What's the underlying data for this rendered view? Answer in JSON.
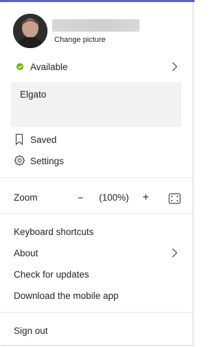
{
  "profile": {
    "change_picture_label": "Change picture"
  },
  "status": {
    "label": "Available",
    "color": "#6bb700",
    "message": "Elgato"
  },
  "menu_top": {
    "saved_label": "Saved",
    "settings_label": "Settings"
  },
  "zoom": {
    "label": "Zoom",
    "minus": "−",
    "level": "(100%)",
    "plus": "+"
  },
  "menu_bottom": {
    "keyboard_shortcuts": "Keyboard shortcuts",
    "about": "About",
    "check_updates": "Check for updates",
    "download_mobile": "Download the mobile app"
  },
  "sign_out_label": "Sign out",
  "colors": {
    "accent": "#5b5fc7",
    "panel_bg": "#ffffff",
    "status_message_bg": "#f3f2f1",
    "text": "#252423"
  }
}
